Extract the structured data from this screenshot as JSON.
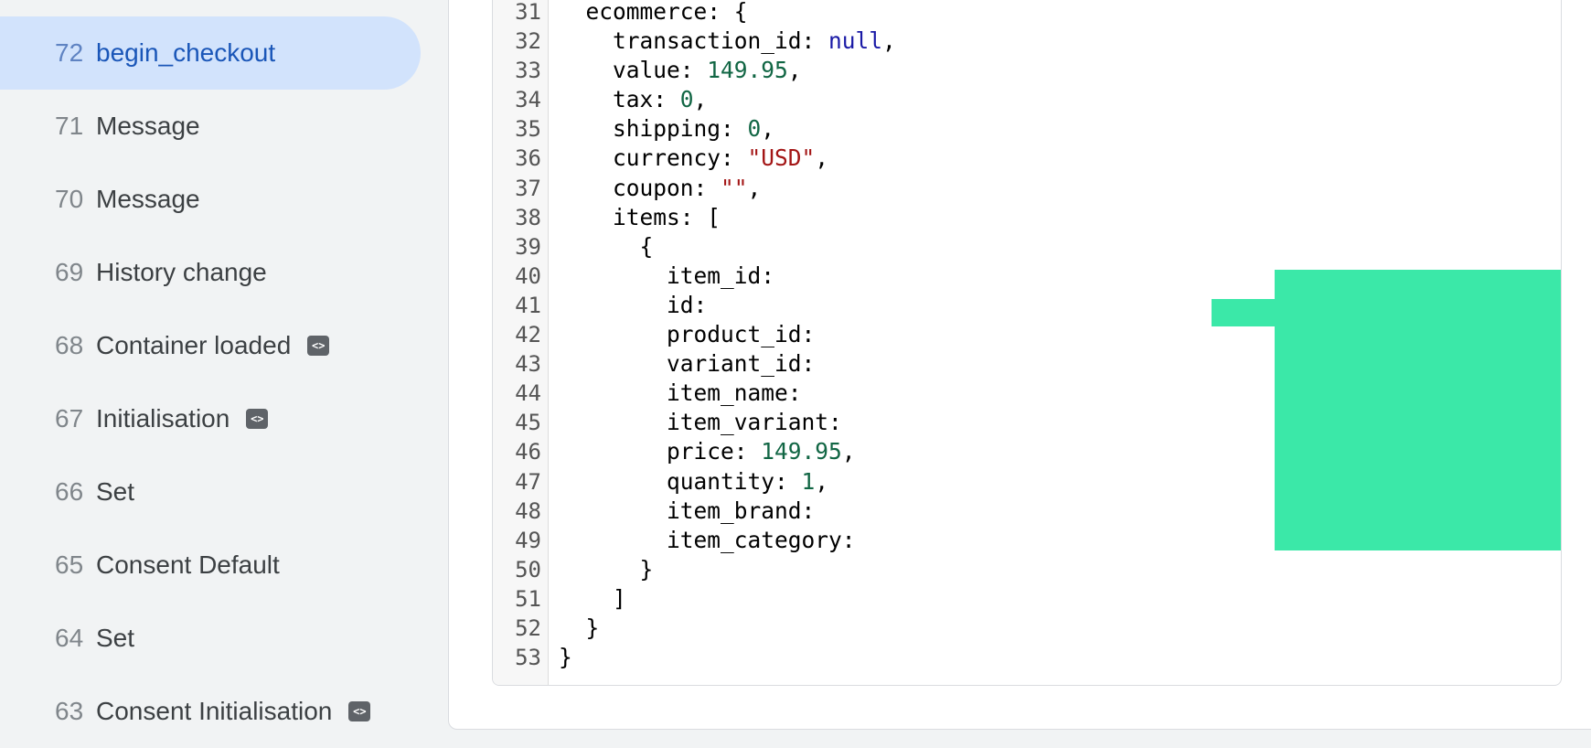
{
  "events": [
    {
      "num": "72",
      "label": "begin_checkout",
      "active": true,
      "tag": false
    },
    {
      "num": "71",
      "label": "Message",
      "active": false,
      "tag": false
    },
    {
      "num": "70",
      "label": "Message",
      "active": false,
      "tag": false
    },
    {
      "num": "69",
      "label": "History change",
      "active": false,
      "tag": false
    },
    {
      "num": "68",
      "label": "Container loaded",
      "active": false,
      "tag": true
    },
    {
      "num": "67",
      "label": "Initialisation",
      "active": false,
      "tag": true
    },
    {
      "num": "66",
      "label": "Set",
      "active": false,
      "tag": false
    },
    {
      "num": "65",
      "label": "Consent Default",
      "active": false,
      "tag": false
    },
    {
      "num": "64",
      "label": "Set",
      "active": false,
      "tag": false
    },
    {
      "num": "63",
      "label": "Consent Initialisation",
      "active": false,
      "tag": true
    }
  ],
  "tag_icon_glyph": "<>",
  "code_lines": [
    {
      "n": "31",
      "segs": [
        {
          "t": "  ecommerce: {",
          "c": ""
        }
      ]
    },
    {
      "n": "32",
      "segs": [
        {
          "t": "    transaction_id: ",
          "c": ""
        },
        {
          "t": "null",
          "c": "null"
        },
        {
          "t": ",",
          "c": ""
        }
      ]
    },
    {
      "n": "33",
      "segs": [
        {
          "t": "    value: ",
          "c": ""
        },
        {
          "t": "149.95",
          "c": "num"
        },
        {
          "t": ",",
          "c": ""
        }
      ]
    },
    {
      "n": "34",
      "segs": [
        {
          "t": "    tax: ",
          "c": ""
        },
        {
          "t": "0",
          "c": "num"
        },
        {
          "t": ",",
          "c": ""
        }
      ]
    },
    {
      "n": "35",
      "segs": [
        {
          "t": "    shipping: ",
          "c": ""
        },
        {
          "t": "0",
          "c": "num"
        },
        {
          "t": ",",
          "c": ""
        }
      ]
    },
    {
      "n": "36",
      "segs": [
        {
          "t": "    currency: ",
          "c": ""
        },
        {
          "t": "\"USD\"",
          "c": "str"
        },
        {
          "t": ",",
          "c": ""
        }
      ]
    },
    {
      "n": "37",
      "segs": [
        {
          "t": "    coupon: ",
          "c": ""
        },
        {
          "t": "\"\"",
          "c": "str"
        },
        {
          "t": ",",
          "c": ""
        }
      ]
    },
    {
      "n": "38",
      "segs": [
        {
          "t": "    items: [",
          "c": ""
        }
      ]
    },
    {
      "n": "39",
      "segs": [
        {
          "t": "      {",
          "c": ""
        }
      ]
    },
    {
      "n": "40",
      "segs": [
        {
          "t": "        item_id: ",
          "c": ""
        }
      ]
    },
    {
      "n": "41",
      "segs": [
        {
          "t": "        id: ",
          "c": ""
        }
      ]
    },
    {
      "n": "42",
      "segs": [
        {
          "t": "        product_id:",
          "c": ""
        }
      ]
    },
    {
      "n": "43",
      "segs": [
        {
          "t": "        variant_id:",
          "c": ""
        }
      ]
    },
    {
      "n": "44",
      "segs": [
        {
          "t": "        item_name: ",
          "c": ""
        }
      ]
    },
    {
      "n": "45",
      "segs": [
        {
          "t": "        item_variant:",
          "c": ""
        }
      ]
    },
    {
      "n": "46",
      "segs": [
        {
          "t": "        price: ",
          "c": ""
        },
        {
          "t": "149.95",
          "c": "num"
        },
        {
          "t": ",",
          "c": ""
        }
      ]
    },
    {
      "n": "47",
      "segs": [
        {
          "t": "        quantity: ",
          "c": ""
        },
        {
          "t": "1",
          "c": "num"
        },
        {
          "t": ",",
          "c": ""
        }
      ]
    },
    {
      "n": "48",
      "segs": [
        {
          "t": "        item_brand:",
          "c": ""
        }
      ]
    },
    {
      "n": "49",
      "segs": [
        {
          "t": "        item_category:",
          "c": ""
        }
      ]
    },
    {
      "n": "50",
      "segs": [
        {
          "t": "      }",
          "c": ""
        }
      ]
    },
    {
      "n": "51",
      "segs": [
        {
          "t": "    ]",
          "c": ""
        }
      ]
    },
    {
      "n": "52",
      "segs": [
        {
          "t": "  }",
          "c": ""
        }
      ]
    },
    {
      "n": "53",
      "segs": [
        {
          "t": "}",
          "c": ""
        }
      ]
    }
  ],
  "colors": {
    "active_bg": "#d2e3fc",
    "active_text": "#1a56b8",
    "redaction": "#3be8a8",
    "null_token": "#1a1aa6",
    "number_token": "#116644",
    "string_token": "#a31515"
  }
}
